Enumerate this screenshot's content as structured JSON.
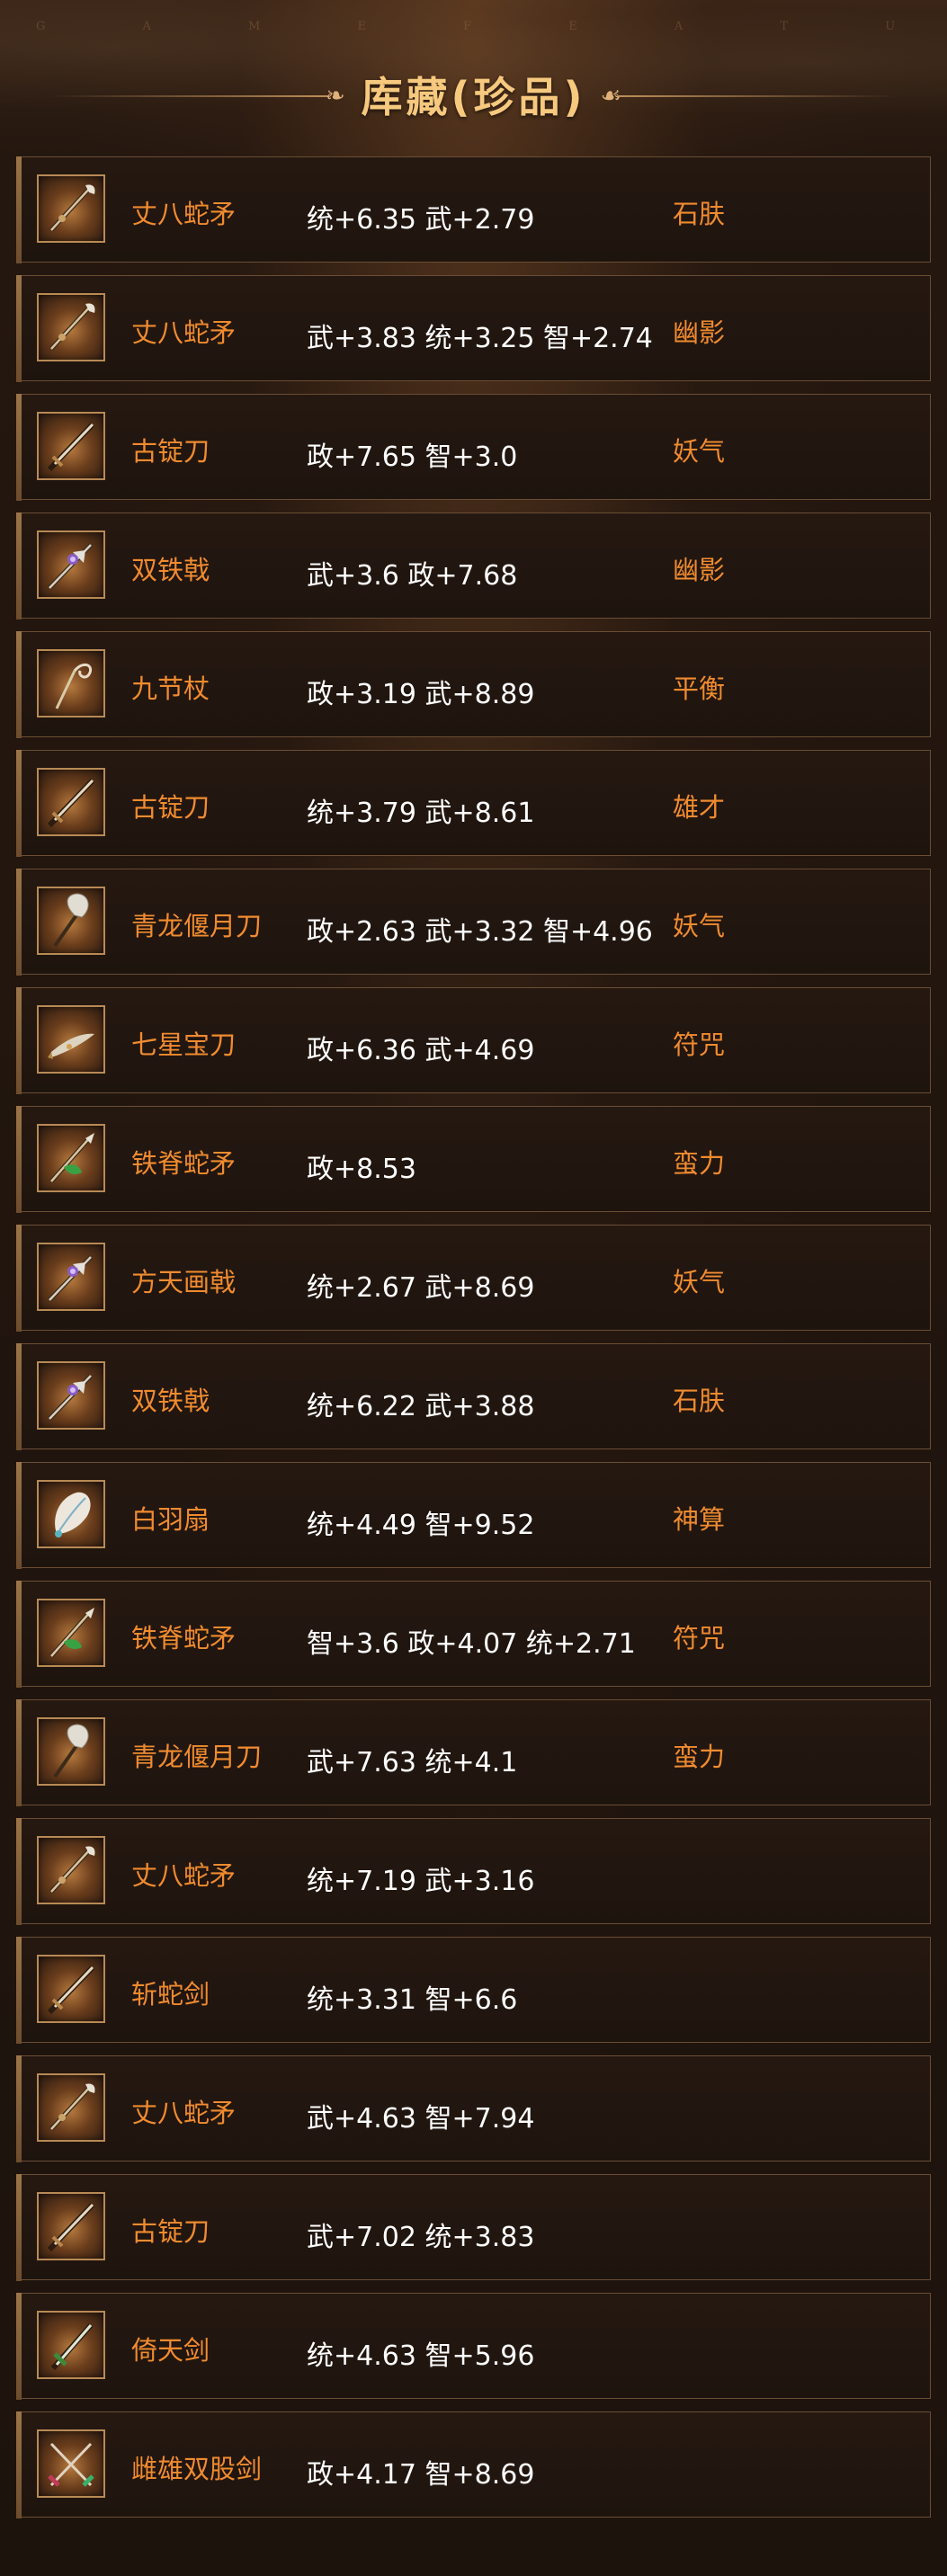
{
  "watermark": "G A M E F E A T U R E S",
  "header": {
    "title": "库藏(珍品)"
  },
  "items": [
    {
      "name": "丈八蛇矛",
      "stats": "统+6.35 武+2.79",
      "trait": "石肤",
      "icon": "spear-icon"
    },
    {
      "name": "丈八蛇矛",
      "stats": "武+3.83 统+3.25 智+2.74",
      "trait": "幽影",
      "icon": "spear-icon"
    },
    {
      "name": "古锭刀",
      "stats": "政+7.65 智+3.0",
      "trait": "妖气",
      "icon": "sword-icon"
    },
    {
      "name": "双铁戟",
      "stats": "武+3.6 政+7.68",
      "trait": "幽影",
      "icon": "halberd-icon"
    },
    {
      "name": "九节杖",
      "stats": "政+3.19 武+8.89",
      "trait": "平衡",
      "icon": "staff-icon"
    },
    {
      "name": "古锭刀",
      "stats": "统+3.79 武+8.61",
      "trait": "雄才",
      "icon": "sword-icon"
    },
    {
      "name": "青龙偃月刀",
      "stats": "政+2.63 武+3.32 智+4.96",
      "trait": "妖气",
      "icon": "glaive-icon"
    },
    {
      "name": "七星宝刀",
      "stats": "政+6.36 武+4.69",
      "trait": "符咒",
      "icon": "blade-icon"
    },
    {
      "name": "铁脊蛇矛",
      "stats": "政+8.53",
      "trait": "蛮力",
      "icon": "serpent-spear-icon"
    },
    {
      "name": "方天画戟",
      "stats": "统+2.67 武+8.69",
      "trait": "妖气",
      "icon": "halberd-icon"
    },
    {
      "name": "双铁戟",
      "stats": "统+6.22 武+3.88",
      "trait": "石肤",
      "icon": "halberd-icon"
    },
    {
      "name": "白羽扇",
      "stats": "统+4.49 智+9.52",
      "trait": "神算",
      "icon": "feather-fan-icon"
    },
    {
      "name": "铁脊蛇矛",
      "stats": "智+3.6 政+4.07 统+2.71",
      "trait": "符咒",
      "icon": "serpent-spear-icon"
    },
    {
      "name": "青龙偃月刀",
      "stats": "武+7.63 统+4.1",
      "trait": "蛮力",
      "icon": "glaive-icon"
    },
    {
      "name": "丈八蛇矛",
      "stats": "统+7.19 武+3.16",
      "trait": "",
      "icon": "spear-icon"
    },
    {
      "name": "斩蛇剑",
      "stats": "统+3.31 智+6.6",
      "trait": "",
      "icon": "sword-icon"
    },
    {
      "name": "丈八蛇矛",
      "stats": "武+4.63 智+7.94",
      "trait": "",
      "icon": "spear-icon"
    },
    {
      "name": "古锭刀",
      "stats": "武+7.02 统+3.83",
      "trait": "",
      "icon": "sword-icon"
    },
    {
      "name": "倚天剑",
      "stats": "统+4.63 智+5.96",
      "trait": "",
      "icon": "green-sword-icon"
    },
    {
      "name": "雌雄双股剑",
      "stats": "政+4.17 智+8.69",
      "trait": "",
      "icon": "twin-swords-icon"
    }
  ]
}
